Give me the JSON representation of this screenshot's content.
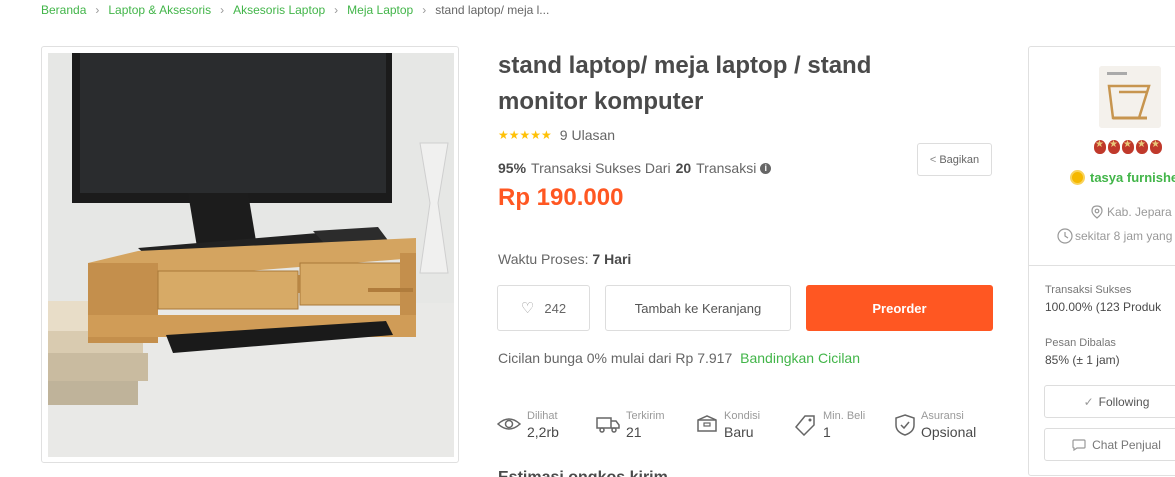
{
  "breadcrumb": {
    "items": [
      "Beranda",
      "Laptop & Aksesoris",
      "Aksesoris Laptop",
      "Meja Laptop"
    ],
    "current": "stand laptop/ meja l..."
  },
  "product": {
    "title": "stand laptop/ meja laptop / stand monitor komputer",
    "stars": "★★★★★",
    "reviews": "9 Ulasan",
    "success_pct": "95%",
    "success_text": "Transaksi Sukses Dari",
    "transaction_count": "20",
    "transaction_label": "Transaksi",
    "price": "Rp 190.000",
    "process_label": "Waktu Proses:",
    "process_value": "7 Hari",
    "wishlist_count": "242",
    "cart_label": "Tambah ke Keranjang",
    "preorder_label": "Preorder",
    "share_label": "Bagikan",
    "installment_text": "Cicilan bunga 0% mulai dari Rp 7.917",
    "installment_link": "Bandingkan Cicilan",
    "stats": {
      "viewed_label": "Dilihat",
      "viewed_value": "2,2rb",
      "sent_label": "Terkirim",
      "sent_value": "21",
      "condition_label": "Kondisi",
      "condition_value": "Baru",
      "min_label": "Min. Beli",
      "min_value": "1",
      "insurance_label": "Asuransi",
      "insurance_value": "Opsional"
    },
    "cutoff_heading": "Estimasi ongkos kirim"
  },
  "seller": {
    "name": "tasya furnishe",
    "location": "Kab. Jepara",
    "last_active": "sekitar 8 jam yang",
    "tx_label": "Transaksi Sukses",
    "tx_value": "100.00% (123 Produk",
    "reply_label": "Pesan Dibalas",
    "reply_value": "85% (± 1 jam)",
    "follow_label": "Following",
    "chat_label": "Chat Penjual"
  },
  "colors": {
    "green": "#42b549",
    "orange": "#ff5722",
    "star": "#ffc107"
  }
}
